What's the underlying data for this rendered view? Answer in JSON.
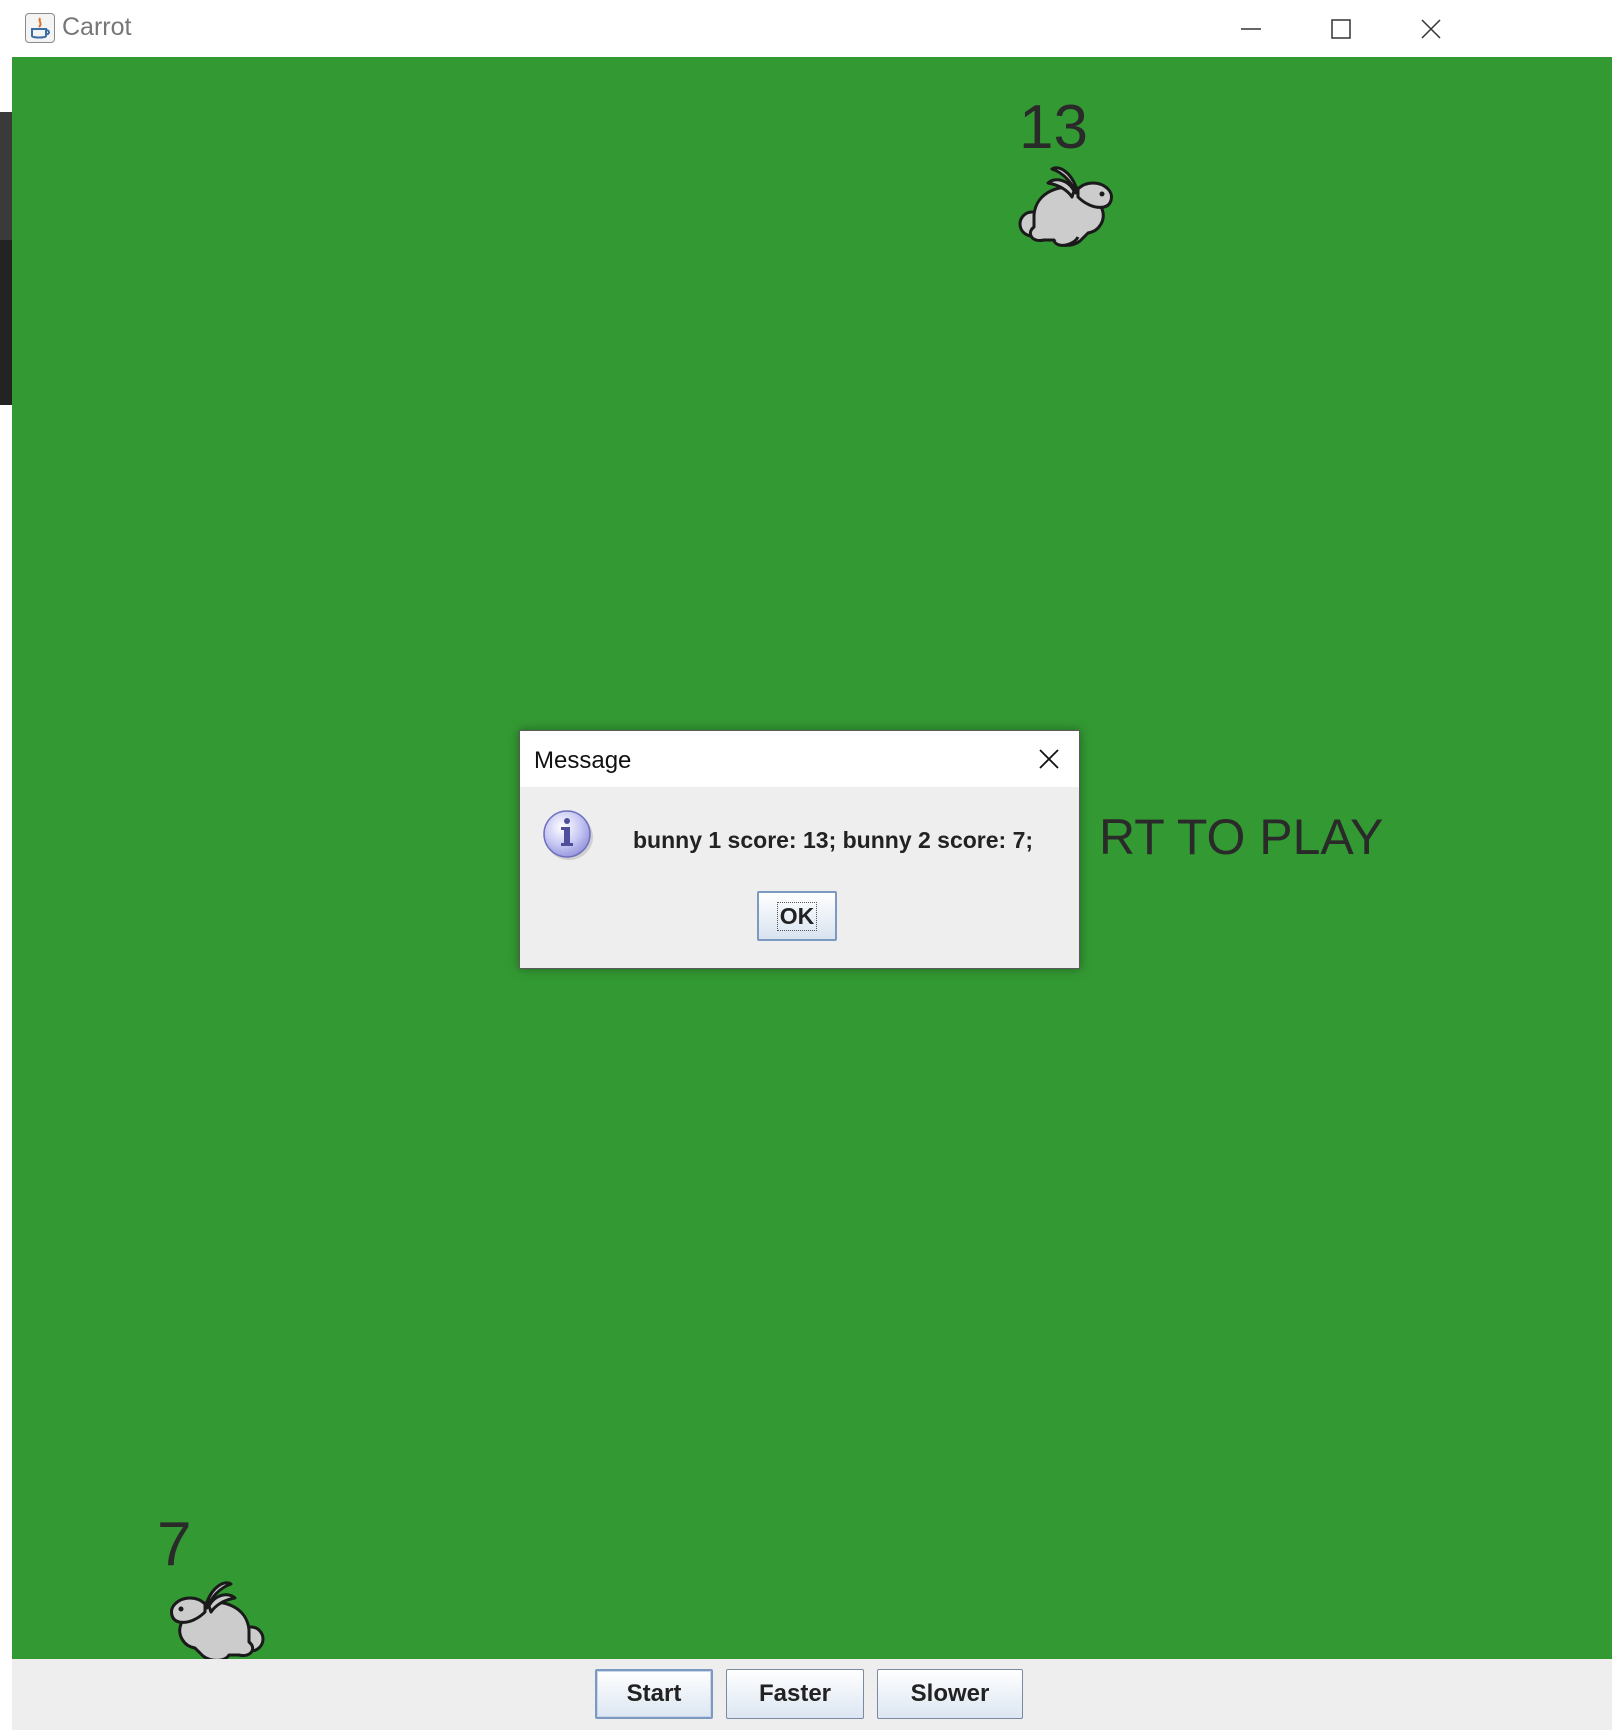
{
  "window": {
    "title": "Carrot",
    "controls": [
      "minimize-icon",
      "maximize-icon",
      "close-icon"
    ]
  },
  "game": {
    "bunny1_score": "13",
    "bunny2_score": "7",
    "prompt_text": "RT TO PLAY",
    "colors": {
      "field": "#339933",
      "bunny_fill": "#cccccc",
      "bunny_outline": "#1a1a1a"
    }
  },
  "dialog": {
    "title": "Message",
    "icon": "info-icon",
    "message": "bunny 1 score: 13; bunny 2 score: 7;",
    "ok_label": "OK"
  },
  "toolbar": {
    "start_label": "Start",
    "faster_label": "Faster",
    "slower_label": "Slower"
  }
}
